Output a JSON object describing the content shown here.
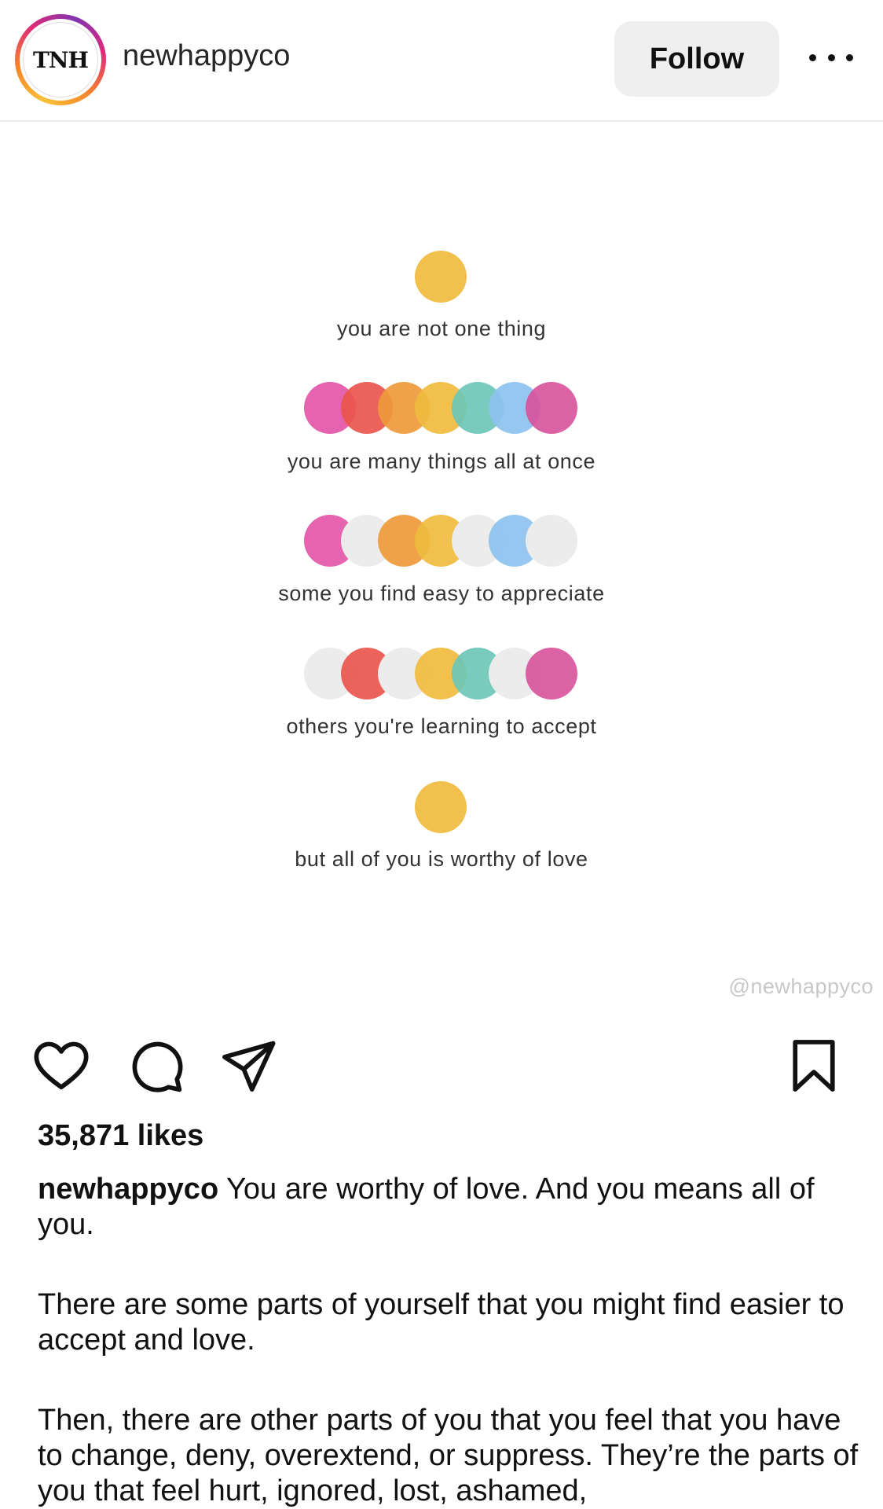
{
  "header": {
    "avatar_text": "TNH",
    "username": "newhappyco",
    "follow_label": "Follow",
    "more_icon": "more-horizontal-icon"
  },
  "post_image": {
    "lines": [
      "you are not one thing",
      "you are many things all at once",
      "some you find easy to appreciate",
      "others you're learning to accept",
      "but all of you is worthy of love"
    ],
    "watermark": "@newhappyco",
    "colors": {
      "yellow": "#f0bb3e",
      "pink": "#e456a8",
      "red": "#e9564c",
      "orange": "#ee9a3b",
      "teal": "#6cc7b7",
      "blue": "#8dc2ef",
      "magenta": "#d9559e",
      "grey": "#ececec"
    }
  },
  "actions": {
    "like_icon": "heart-icon",
    "comment_icon": "comment-icon",
    "share_icon": "share-icon",
    "save_icon": "bookmark-icon"
  },
  "likes": "35,871 likes",
  "caption": {
    "owner": "newhappyco",
    "text": " You are worthy of love. And you means all of you.",
    "para2": "There are some parts of yourself that you might find easier to accept and love.",
    "para3": "Then, there are other parts of you that you feel that you have to change, deny, overextend, or suppress. They’re the parts of you that feel hurt, ignored, lost, ashamed,"
  }
}
